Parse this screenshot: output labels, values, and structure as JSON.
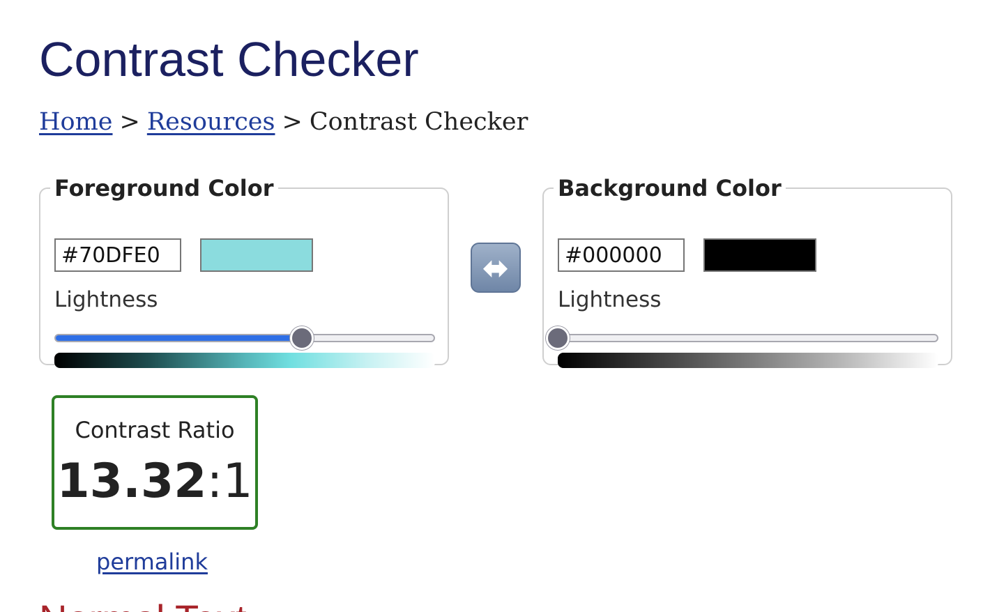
{
  "page": {
    "title": "Contrast Checker"
  },
  "breadcrumb": {
    "home": "Home",
    "resources": "Resources",
    "current": "Contrast Checker",
    "separator": ">"
  },
  "foreground": {
    "legend": "Foreground Color",
    "hex": "#70DFE0",
    "swatch_color": "#8BDCDE",
    "lightness_label": "Lightness",
    "lightness_percent": 65
  },
  "background": {
    "legend": "Background Color",
    "hex": "#000000",
    "swatch_color": "#000000",
    "lightness_label": "Lightness",
    "lightness_percent": 0
  },
  "swap": {
    "icon": "left-right-arrow-icon",
    "glyph": "⬌"
  },
  "result": {
    "label": "Contrast Ratio",
    "ratio": "13.32",
    "separator": ":",
    "suffix": "1",
    "border_color": "#2E8025"
  },
  "permalink": "permalink",
  "next_section": {
    "heading": "Normal Text"
  }
}
